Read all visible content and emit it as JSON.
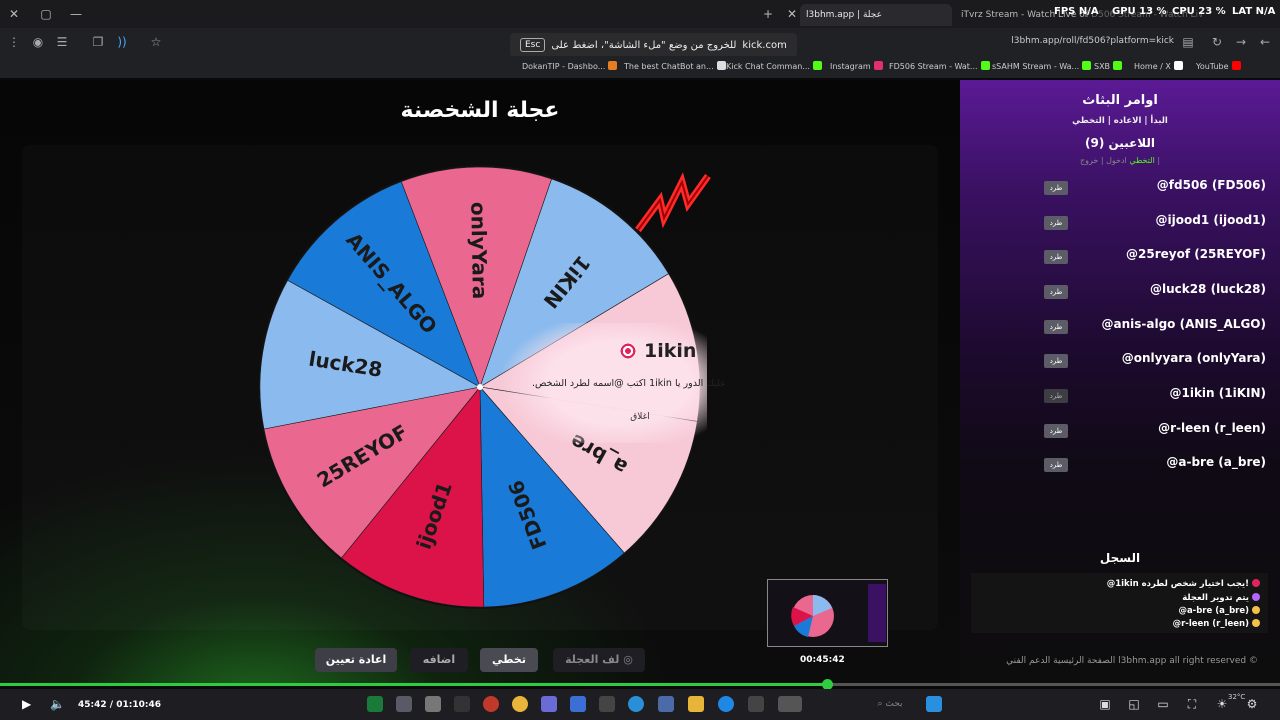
{
  "browser": {
    "tabs": [
      {
        "label": "l3bhm.app | عجلة"
      },
      {
        "label": "iTvrz Stream - Watch Live on K"
      },
      {
        "label": "FD506 Stream - Watch Live on"
      }
    ],
    "perf": {
      "fps": "FPS N/A",
      "gpu": "GPU 13 %",
      "cpu": "CPU 23 %",
      "lat": "LAT N/A"
    },
    "url": "l3bhm.app/roll/fd506?platform=kick",
    "fullscreen_notice": {
      "site": "kick.com",
      "text": "للخروج من وضع \"ملء الشاشة\"، اضغط على",
      "key": "Esc"
    },
    "bookmarks": [
      {
        "label": "DokanTIP - Dashbo...",
        "color": "#e67e22"
      },
      {
        "label": "The best ChatBot an...",
        "color": "#dddddd"
      },
      {
        "label": "Kick Chat Comman...",
        "color": "#53fc18"
      },
      {
        "label": "Instagram",
        "color": "#e1306c"
      },
      {
        "label": "FD506 Stream - Wat...",
        "color": "#53fc18"
      },
      {
        "label": "sSAHM Stream - Wa...",
        "color": "#53fc18"
      },
      {
        "label": "SXB",
        "color": "#53fc18"
      },
      {
        "label": "Home / X",
        "color": "#ffffff"
      },
      {
        "label": "YouTube",
        "color": "#ff0000"
      }
    ]
  },
  "main": {
    "title": "عجلة الشخصنة",
    "wheel": {
      "segments": [
        {
          "label": "onlyYara",
          "color": "#ea6890"
        },
        {
          "label": "1iKIN",
          "color": "#8bbbee"
        },
        {
          "label": "",
          "color": "#f7c8d6"
        },
        {
          "label": "a_bre",
          "color": "#f7c8d6"
        },
        {
          "label": "FD506",
          "color": "#1a7ad8"
        },
        {
          "label": "ijood1",
          "color": "#dc1349"
        },
        {
          "label": "25REYOF",
          "color": "#ea6890"
        },
        {
          "label": "luck28",
          "color": "#8bbbee"
        },
        {
          "label": "ANIS_ALGO",
          "color": "#1a7ad8"
        }
      ]
    },
    "popup": {
      "winner": "1ikin",
      "message": "عليك الدور يا 1ikin اكتب @اسمه لطرد الشخص.",
      "close": "اغلاق"
    },
    "buttons": {
      "reset": "اعادة تعيين",
      "add": "اضافه",
      "skip": "تخطي",
      "spin": "لف العجلة"
    }
  },
  "sidebar": {
    "title": "اوامر البثاث",
    "commands": "البدأ | الاعاده | التخطي",
    "players_label": "اللاعبين (9)",
    "player_cmds_plain": "ادخول | خروج |",
    "player_cmds_green": "التخطي",
    "kick_label": "طرد",
    "players": [
      "@fd506 (FD506)",
      "@ijood1 (ijood1)",
      "@25reyof (25REYOF)",
      "@luck28 (luck28)",
      "@anis-algo (ANIS_ALGO)",
      "@onlyyara (onlyYara)",
      "@1ikin (1iKIN)",
      "@r-leen (r_leen)",
      "@a-bre (a_bre)"
    ],
    "log_title": "السجل",
    "log": [
      "@1ikin يجب اختيار شخص لطرده!",
      "يتم تدوير العجلة",
      "@a-bre (a_bre)",
      "@r-leen (r_leen)"
    ],
    "footer": "الصفحة الرئيسية   الدعم الفني   l3bhm.app all right reserved ©"
  },
  "player_bar": {
    "time": "45:42 / 01:10:46",
    "preview_time": "00:45:42",
    "progress": 0.646
  },
  "taskbar": {
    "search_placeholder": "بحث",
    "tray": {
      "temp": "32°C"
    }
  }
}
